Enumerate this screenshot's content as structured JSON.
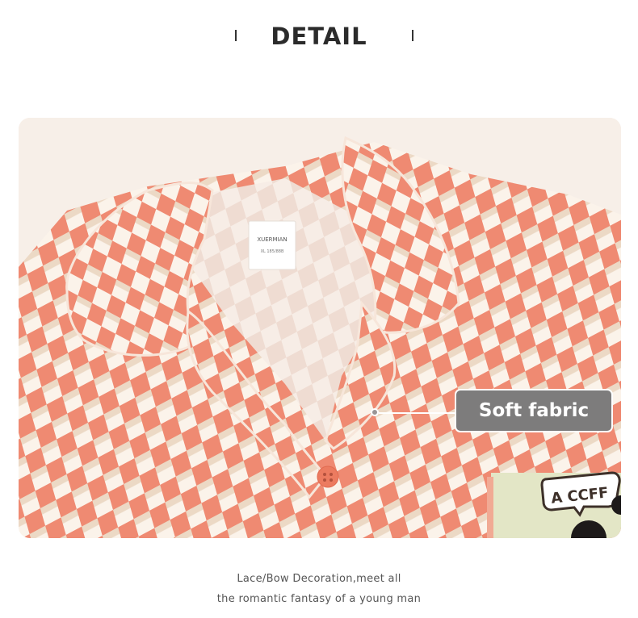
{
  "header": {
    "title": "DETAIL"
  },
  "photo": {
    "label_brand": "XUERMIAN",
    "label_size": "XL 185/88B",
    "pocket_text": "A CCFF",
    "colors": {
      "coral": "#ef8a72",
      "cream": "#fbf3ea",
      "beige": "#ead8c4",
      "pocket": "#e3e6c6"
    }
  },
  "callout": {
    "text": "Soft fabric"
  },
  "caption": {
    "line1": "Lace/Bow Decoration,meet all",
    "line2": "the romantic fantasy of a young man"
  }
}
